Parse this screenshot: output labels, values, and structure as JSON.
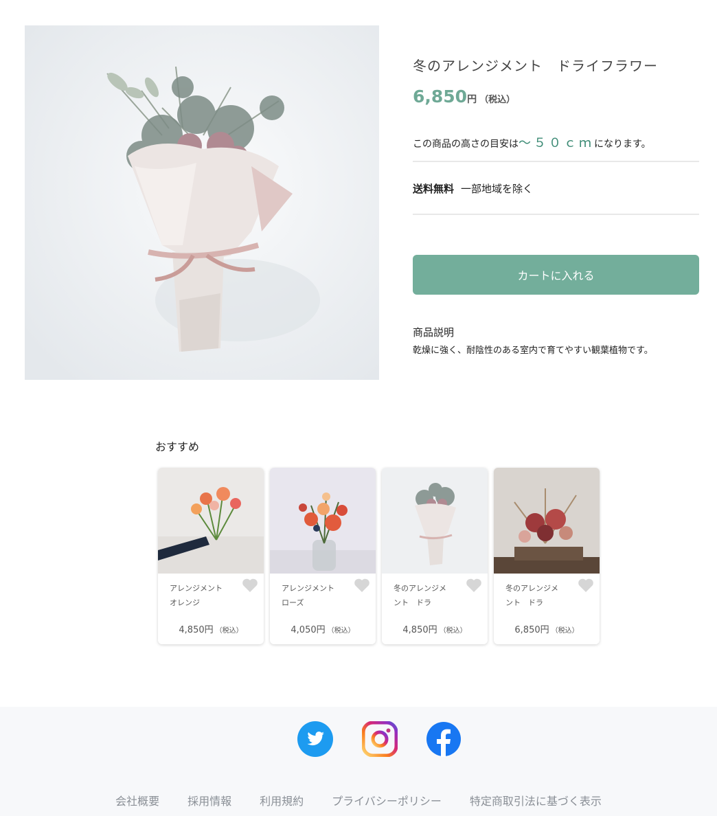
{
  "product": {
    "title": "冬のアレンジメント　ドライフラワー",
    "price": "6,850",
    "price_unit": "円",
    "tax_label": "（税込）",
    "height_prefix": "この商品の高さの目安は",
    "height_value": "〜５０ｃｍ",
    "height_suffix": "になります。",
    "shipping_label": "送料無料",
    "shipping_note": "一部地域を除く",
    "cart_button": "カートに入れる",
    "description_title": "商品説明",
    "description_text": "乾燥に強く、耐陰性のある室内で育てやすい観葉植物です。",
    "image_icon": "bouquet-image"
  },
  "recommend": {
    "heading": "おすすめ",
    "items": [
      {
        "name": "アレンジメント　オレンジ",
        "price": "4,850円",
        "tax": "（税込）"
      },
      {
        "name": "アレンジメント　ローズ",
        "price": "4,050円",
        "tax": "（税込）"
      },
      {
        "name": "冬のアレンジメント　ドラ",
        "price": "4,850円",
        "tax": "（税込）"
      },
      {
        "name": "冬のアレンジメント　ドラ",
        "price": "6,850円",
        "tax": "（税込）"
      }
    ]
  },
  "footer": {
    "social": [
      "twitter-icon",
      "instagram-icon",
      "facebook-icon"
    ],
    "links": [
      "会社概要",
      "採用情報",
      "利用規約",
      "プライバシーポリシー",
      "特定商取引法に基づく表示"
    ]
  },
  "colors": {
    "accent": "#73ae9b",
    "price": "#6fa996",
    "twitter": "#1d9bf0",
    "facebook": "#1877f2"
  }
}
